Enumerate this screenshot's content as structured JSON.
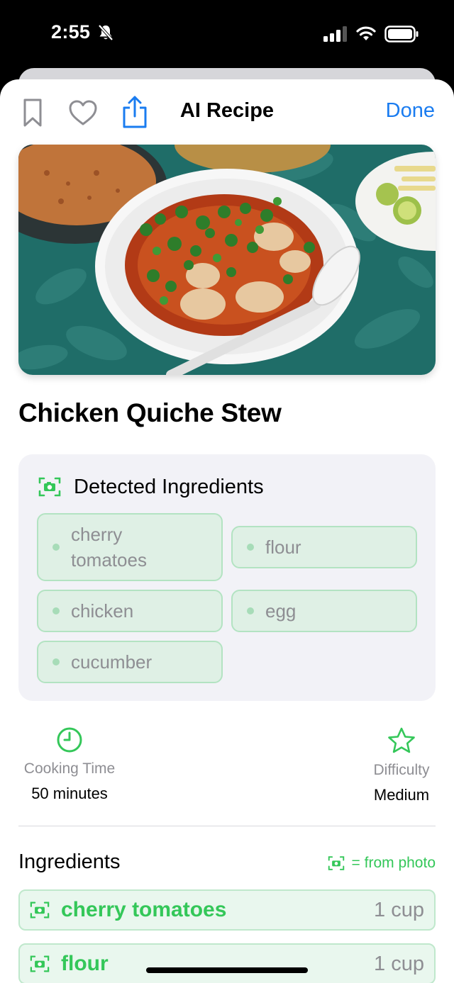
{
  "status_bar": {
    "time": "2:55",
    "icons": [
      "bell-slash-icon",
      "signal-icon",
      "wifi-icon",
      "battery-icon"
    ]
  },
  "navbar": {
    "title": "AI Recipe",
    "done_label": "Done",
    "icons": [
      "bookmark-icon",
      "heart-icon",
      "share-icon"
    ]
  },
  "recipe": {
    "title": "Chicken Quiche Stew"
  },
  "detected": {
    "title": "Detected Ingredients",
    "items": [
      "cherry tomatoes",
      "flour",
      "chicken",
      "egg",
      "cucumber"
    ]
  },
  "stats": {
    "cooking_time": {
      "label": "Cooking Time",
      "value": "50 minutes"
    },
    "difficulty": {
      "label": "Difficulty",
      "value": "Medium"
    }
  },
  "ingredients": {
    "heading": "Ingredients",
    "legend": "= from photo",
    "items": [
      {
        "name": "cherry tomatoes",
        "qty": "1 cup"
      },
      {
        "name": "flour",
        "qty": "1 cup"
      }
    ]
  },
  "colors": {
    "accent_blue": "#1a7cf0",
    "accent_green": "#34c759",
    "chip_bg": "#dff0e5",
    "card_bg": "#f2f2f7"
  }
}
